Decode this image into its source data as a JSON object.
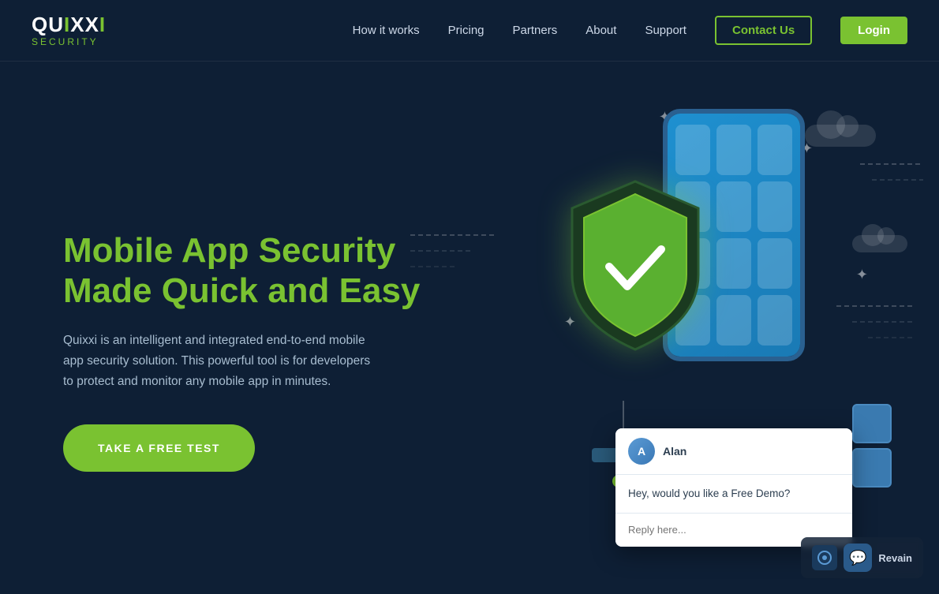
{
  "logo": {
    "brand": "QUIXXI",
    "sub": "Security"
  },
  "nav": {
    "links": [
      {
        "id": "how-it-works",
        "label": "How it works"
      },
      {
        "id": "pricing",
        "label": "Pricing"
      },
      {
        "id": "partners",
        "label": "Partners"
      },
      {
        "id": "about",
        "label": "About"
      },
      {
        "id": "support",
        "label": "Support"
      },
      {
        "id": "contact-us",
        "label": "Contact Us"
      },
      {
        "id": "login",
        "label": "Login"
      }
    ]
  },
  "hero": {
    "title": "Mobile App Security Made Quick and Easy",
    "description": "Quixxi is an intelligent and integrated end-to-end mobile app security solution. This powerful tool is for developers to protect and monitor any mobile app in minutes.",
    "cta_label": "TAKE A FREE TEST"
  },
  "chat": {
    "agent_name": "Alan",
    "message": "Hey, would you like a Free Demo?",
    "input_placeholder": "Reply here..."
  },
  "revain": {
    "label": "Revain"
  },
  "colors": {
    "accent": "#7ac231",
    "bg": "#0e1f35",
    "nav_link": "#cdd8e8",
    "desc_text": "#a8bdd0"
  }
}
